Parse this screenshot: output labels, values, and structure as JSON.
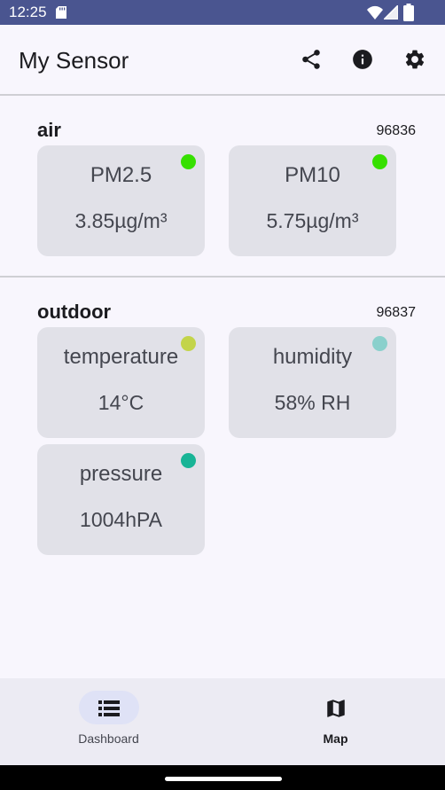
{
  "status_bar": {
    "time": "12:25"
  },
  "app_bar": {
    "title": "My Sensor",
    "actions": [
      "share-icon",
      "info-icon",
      "settings-icon"
    ]
  },
  "sections": [
    {
      "title": "air",
      "id": "96836",
      "cards": [
        {
          "label": "PM2.5",
          "value": "3.85µg/m³",
          "dot_color": "#36e000"
        },
        {
          "label": "PM10",
          "value": "5.75µg/m³",
          "dot_color": "#36e000"
        }
      ]
    },
    {
      "title": "outdoor",
      "id": "96837",
      "cards": [
        {
          "label": "temperature",
          "value": "14°C",
          "dot_color": "#c3d44a"
        },
        {
          "label": "humidity",
          "value": "58% RH",
          "dot_color": "#8ad0cc"
        },
        {
          "label": "pressure",
          "value": "1004hPA",
          "dot_color": "#18b496"
        }
      ]
    }
  ],
  "bottom_nav": {
    "items": [
      {
        "label": "Dashboard",
        "icon": "list-icon",
        "selected": true
      },
      {
        "label": "Map",
        "icon": "map-icon",
        "selected": false
      }
    ]
  },
  "colors": {
    "status_bar": "#4a5590",
    "background": "#f8f6fd",
    "card": "#e1e1e8",
    "nav_pill": "#dfe2f6"
  }
}
